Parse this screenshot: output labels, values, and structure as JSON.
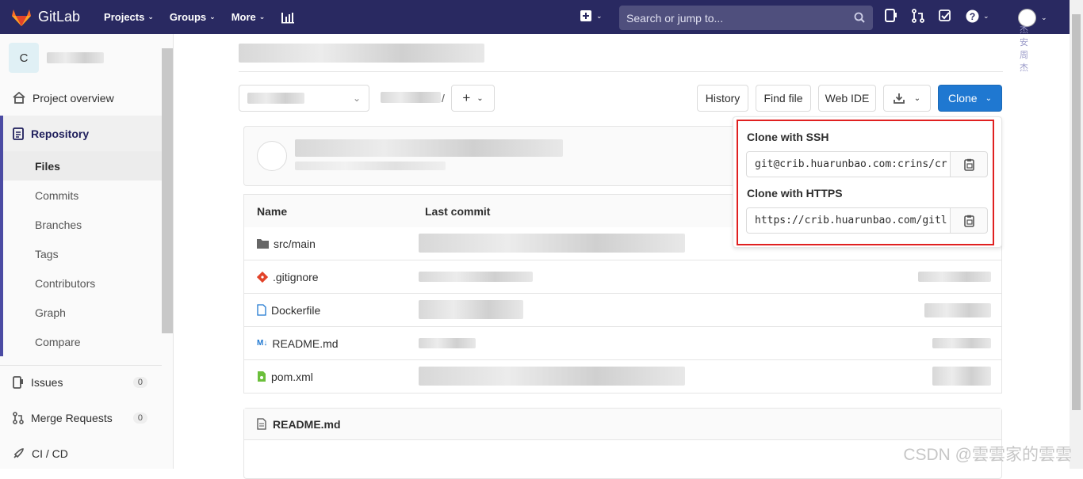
{
  "navbar": {
    "brand": "GitLab",
    "links": [
      {
        "label": "Projects"
      },
      {
        "label": "Groups"
      },
      {
        "label": "More"
      }
    ],
    "search_placeholder": "Search or jump to...",
    "user_chars": "杰\n安\n周\n杰"
  },
  "sidebar": {
    "project_initial": "C",
    "items": {
      "overview": "Project overview",
      "repository": "Repository",
      "issues": "Issues",
      "merge_requests": "Merge Requests",
      "ci_cd": "CI / CD"
    },
    "repo_sub": [
      "Files",
      "Commits",
      "Branches",
      "Tags",
      "Contributors",
      "Graph",
      "Compare"
    ],
    "issues_count": "0",
    "mr_count": "0"
  },
  "toolbar": {
    "history": "History",
    "find_file": "Find file",
    "web_ide": "Web IDE",
    "clone": "Clone",
    "path_sep": "/"
  },
  "table": {
    "col_name": "Name",
    "col_last_commit": "Last commit",
    "files": [
      "src/main",
      ".gitignore",
      "Dockerfile",
      "README.md",
      "pom.xml"
    ]
  },
  "readme": {
    "title": "README.md"
  },
  "clone_dropdown": {
    "ssh_label": "Clone with SSH",
    "ssh_url": "git@crib.huarunbao.com:crins/cr",
    "https_label": "Clone with HTTPS",
    "https_url": "https://crib.huarunbao.com/gitl"
  },
  "watermark": "CSDN @雲雲家的雲雲"
}
